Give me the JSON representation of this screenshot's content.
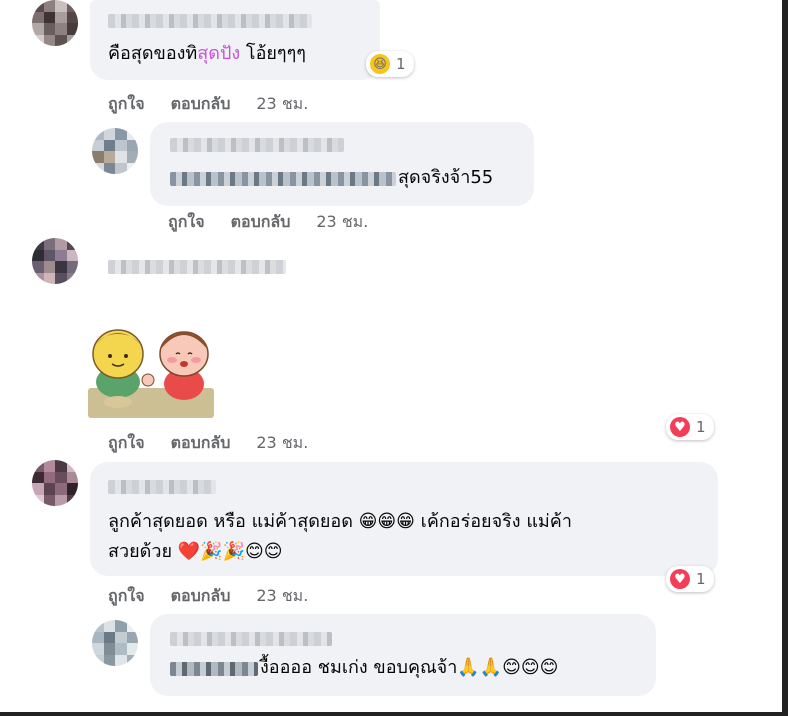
{
  "comments": [
    {
      "text_before": "คือสุดของทิ",
      "text_highlight": "สุดปัง",
      "text_after": " โอ้ยๆๆๆ",
      "reaction_count": "1",
      "reaction_icon": "laugh-reaction-icon",
      "like_label": "ถูกใจ",
      "reply_label": "ตอบกลับ",
      "time": "23 ชม."
    },
    {
      "text": " สุดจริงจ้า55",
      "like_label": "ถูกใจ",
      "reply_label": "ตอบกลับ",
      "time": "23 ชม."
    },
    {
      "sticker": "two-kids-sticker",
      "reaction_count": "1",
      "reaction_icon": "heart-reaction-icon",
      "like_label": "ถูกใจ",
      "reply_label": "ตอบกลับ",
      "time": "23 ชม."
    },
    {
      "line1": "ลูกค้าสุดยอด หรือ แม่ค้าสุดยอด 😁😁😁 เค้กอร่อยจริง แม่ค้า",
      "line2": "สวยด้วย ❤️🎉🎉😊😊",
      "reaction_count": "1",
      "reaction_icon": "heart-reaction-icon",
      "like_label": "ถูกใจ",
      "reply_label": "ตอบกลับ",
      "time": "23 ชม."
    },
    {
      "text": " งื้ออออ ชมเก่ง ขอบคุณจ้า🙏🙏😊😊😊"
    }
  ],
  "colors": {
    "bubble": "#f0f2f5",
    "meta": "#65676b",
    "highlight": "#c94fe0",
    "heart": "#f33e58"
  }
}
